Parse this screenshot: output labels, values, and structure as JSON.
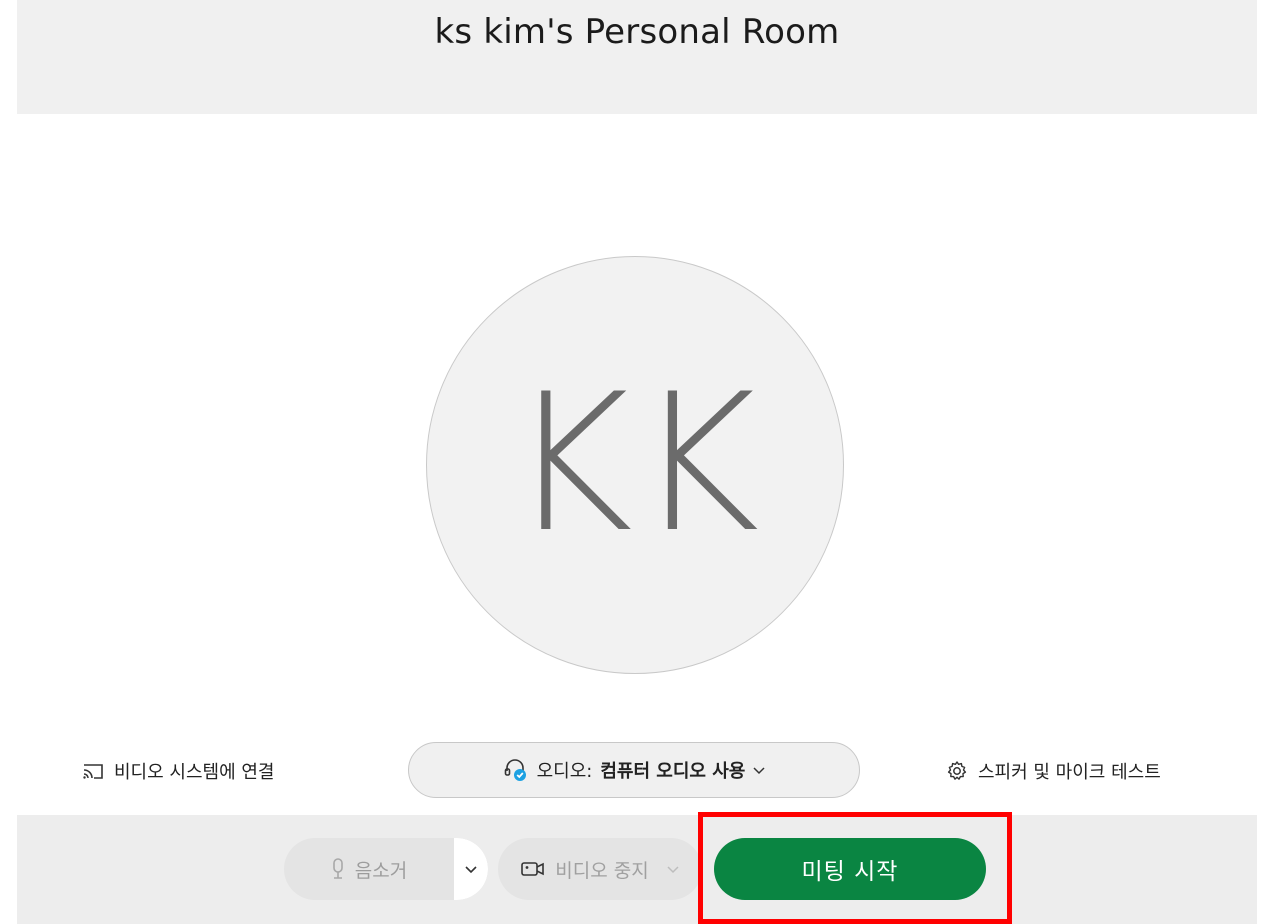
{
  "header": {
    "title": "ks kim's Personal Room"
  },
  "avatar": {
    "initials": "KK"
  },
  "options": {
    "connect_video_label": "비디오 시스템에 연결",
    "connect_video_icon": "cast-icon",
    "audio_prefix": "오디오:",
    "audio_value": "컴퓨터 오디오 사용",
    "audio_icon": "headset-icon",
    "speaker_test_label": "스피커 및 마이크 테스트",
    "speaker_test_icon": "gear-icon"
  },
  "controls": {
    "mute_label": "음소거",
    "mute_icon": "microphone-icon",
    "video_label": "비디오 중지",
    "video_icon": "camera-icon",
    "start_label": "미팅 시작"
  },
  "colors": {
    "start_button": "#0a8542",
    "highlight": "#ff0000",
    "header_bg": "#f0f0f0",
    "audio_badge": "#1da1e2"
  }
}
